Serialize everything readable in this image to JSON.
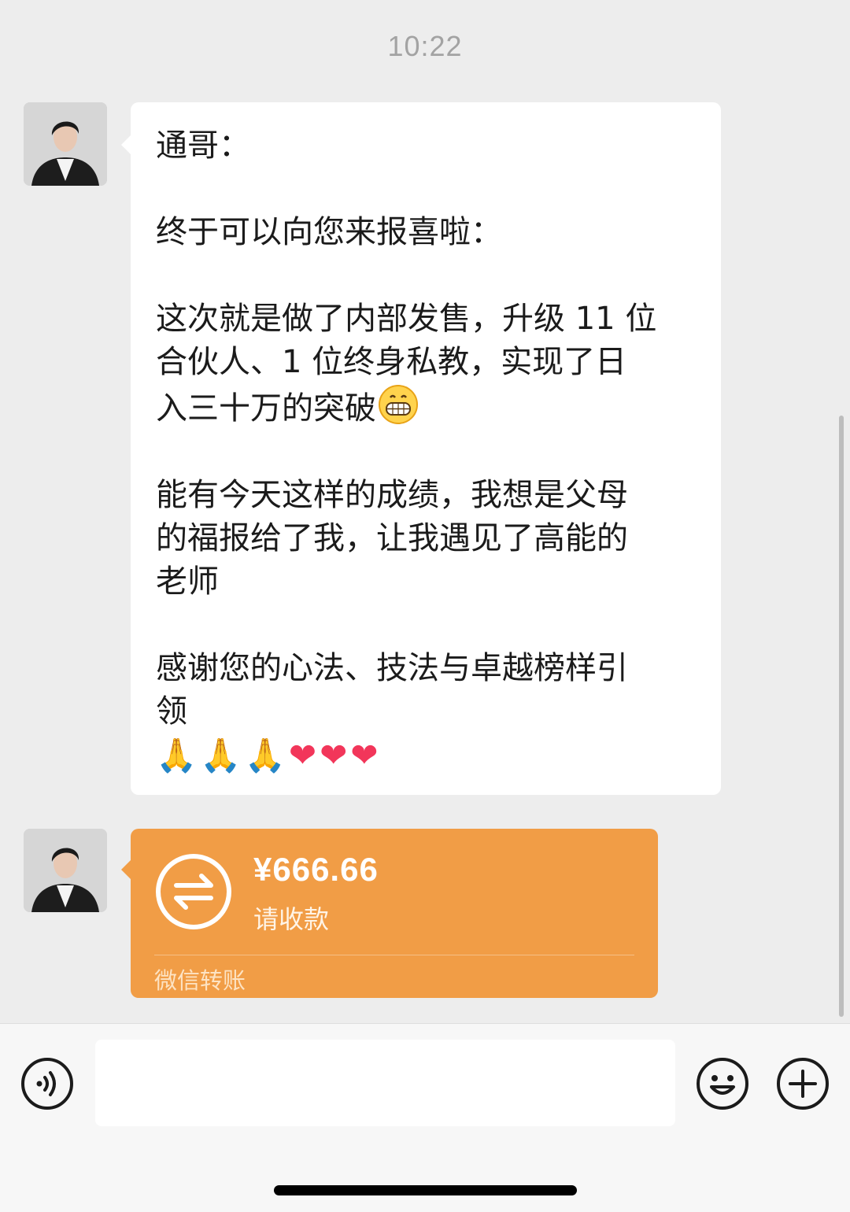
{
  "timestamp": "10:22",
  "messages": {
    "text": {
      "lines_1": "通哥：",
      "lines_2": "终于可以向您来报喜啦：",
      "lines_3": "这次就是做了内部发售，升级 11 位\n合伙人、1 位终身私教，实现了日\n入三十万的突破",
      "lines_3_emoji": "grinning-face-icon",
      "lines_4": "能有今天这样的成绩，我想是父母\n的福报给了我，让我遇见了高能的\n老师",
      "lines_5": "感谢您的心法、技法与卓越榜样引\n领",
      "emojis": [
        "🙏",
        "🙏",
        "🙏",
        "❤",
        "❤",
        "❤"
      ]
    },
    "transfer": {
      "amount": "¥666.66",
      "status": "请收款",
      "label": "微信转账",
      "color": "#f19d46"
    }
  },
  "input_bar": {
    "placeholder": "",
    "icons": [
      "voice-icon",
      "emoji-icon",
      "plus-icon"
    ]
  }
}
